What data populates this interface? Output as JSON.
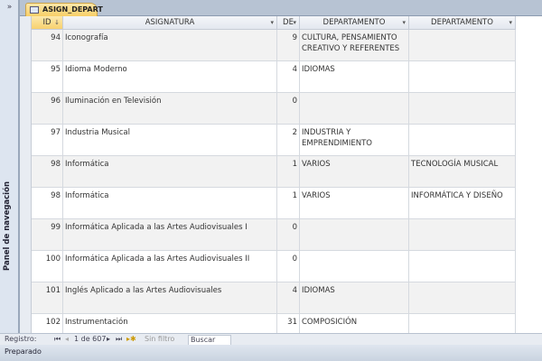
{
  "nav_pane": {
    "label": "Panel de navegación",
    "expand_icon": "»"
  },
  "tab": {
    "title": "ASIGN_DEPART"
  },
  "columns": [
    {
      "label": "ID",
      "sort": "↓"
    },
    {
      "label": "ASIGNATURA",
      "sort": "▾"
    },
    {
      "label": "DE",
      "sort": "▾"
    },
    {
      "label": "DEPARTAMENTO",
      "sort": "▾"
    },
    {
      "label": "DEPARTAMENTO",
      "sort": "▾"
    }
  ],
  "rows": [
    {
      "id": "94",
      "asig": "Iconografía",
      "de": "9",
      "dep1": "CULTURA, PENSAMIENTO CREATIVO Y REFERENTES",
      "dep2": ""
    },
    {
      "id": "95",
      "asig": "Idioma Moderno",
      "de": "4",
      "dep1": "IDIOMAS",
      "dep2": ""
    },
    {
      "id": "96",
      "asig": "Iluminación en Televisión",
      "de": "0",
      "dep1": "",
      "dep2": ""
    },
    {
      "id": "97",
      "asig": "Industria Musical",
      "de": "2",
      "dep1": "INDUSTRIA Y EMPRENDIMIENTO",
      "dep2": ""
    },
    {
      "id": "98",
      "asig": "Informática",
      "de": "1",
      "dep1": "VARIOS",
      "dep2": "TECNOLOGÍA MUSICAL"
    },
    {
      "id": "98",
      "asig": "Informática",
      "de": "1",
      "dep1": "VARIOS",
      "dep2": "INFORMÁTICA Y DISEÑO"
    },
    {
      "id": "99",
      "asig": "Informática Aplicada a las Artes Audiovisuales I",
      "de": "0",
      "dep1": "",
      "dep2": ""
    },
    {
      "id": "100",
      "asig": "Informática Aplicada a las Artes Audiovisuales II",
      "de": "0",
      "dep1": "",
      "dep2": ""
    },
    {
      "id": "101",
      "asig": "Inglés Aplicado a las Artes Audiovisuales",
      "de": "4",
      "dep1": "IDIOMAS",
      "dep2": ""
    },
    {
      "id": "102",
      "asig": "Instrumentación",
      "de": "31",
      "dep1": "COMPOSICIÓN",
      "dep2": ""
    }
  ],
  "record_nav": {
    "label": "Registro:",
    "first": "⏮",
    "prev": "◂",
    "position": "1 de 607",
    "next": "▸",
    "last": "⏭",
    "new": "▸✱",
    "filter": "Sin filtro",
    "search": "Buscar"
  },
  "status": "Preparado"
}
